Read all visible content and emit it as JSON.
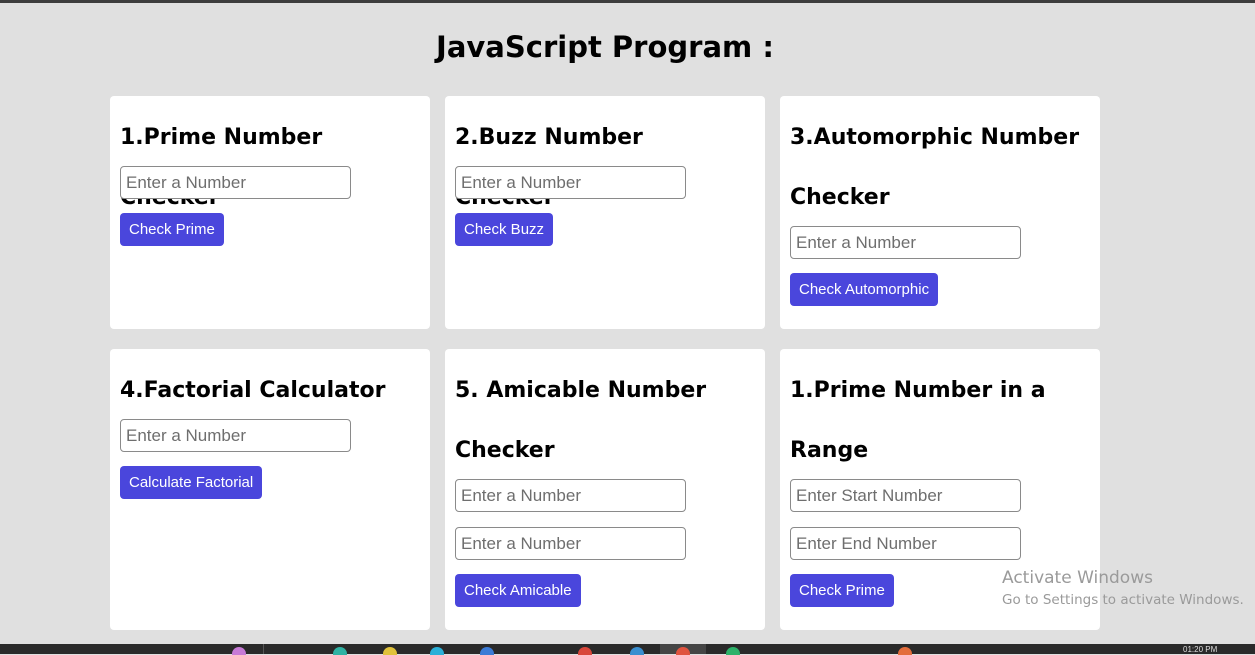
{
  "page": {
    "title": "JavaScript Program :"
  },
  "cards": [
    {
      "heading": "1.Prime Number Checker",
      "inputs": [
        {
          "placeholder": "Enter a Number"
        }
      ],
      "button": "Check Prime"
    },
    {
      "heading": "2.Buzz Number Checker",
      "inputs": [
        {
          "placeholder": "Enter a Number"
        }
      ],
      "button": "Check Buzz"
    },
    {
      "heading": "3.Automorphic Number Checker",
      "inputs": [
        {
          "placeholder": "Enter a Number"
        }
      ],
      "button": "Check Automorphic"
    },
    {
      "heading": "4.Factorial Calculator",
      "inputs": [
        {
          "placeholder": "Enter a Number"
        }
      ],
      "button": "Calculate Factorial"
    },
    {
      "heading": "5. Amicable Number Checker",
      "inputs": [
        {
          "placeholder": "Enter a Number"
        },
        {
          "placeholder": "Enter a Number"
        }
      ],
      "button": "Check Amicable"
    },
    {
      "heading": "1.Prime Number in a Range",
      "inputs": [
        {
          "placeholder": "Enter Start Number"
        },
        {
          "placeholder": "Enter End Number"
        }
      ],
      "button": "Check Prime"
    }
  ],
  "watermark": {
    "title": "Activate Windows",
    "subtitle": "Go to Settings to activate Windows."
  },
  "taskbar": {
    "clock": "01:20 PM"
  },
  "colors": {
    "background": "#e0e0e0",
    "card": "#ffffff",
    "button": "#4a46dc",
    "button_text": "#ffffff",
    "watermark": "#9a9a9a"
  }
}
